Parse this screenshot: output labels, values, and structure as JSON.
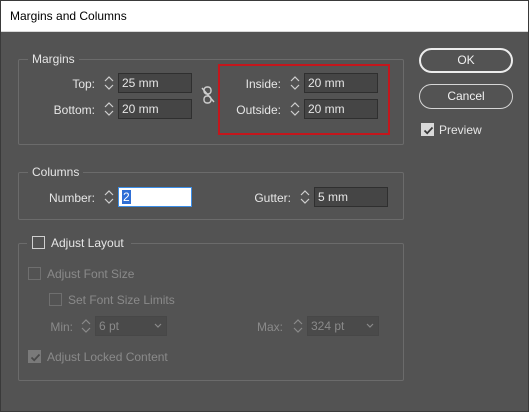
{
  "window": {
    "title": "Margins and Columns"
  },
  "margins": {
    "legend": "Margins",
    "top": {
      "label": "Top:",
      "value": "25 mm"
    },
    "bottom": {
      "label": "Bottom:",
      "value": "20 mm"
    },
    "inside": {
      "label": "Inside:",
      "value": "20 mm"
    },
    "outside": {
      "label": "Outside:",
      "value": "20 mm"
    },
    "link_icon": "broken-chain-icon"
  },
  "columns": {
    "legend": "Columns",
    "number": {
      "label": "Number:",
      "value": "2"
    },
    "gutter": {
      "label": "Gutter:",
      "value": "5 mm"
    }
  },
  "adjust_layout": {
    "label": "Adjust Layout",
    "checked": false,
    "adjust_font_size": {
      "label": "Adjust Font Size",
      "checked": false,
      "enabled": false
    },
    "set_font_size_limits": {
      "label": "Set Font Size Limits",
      "checked": false,
      "enabled": false
    },
    "min": {
      "label": "Min:",
      "value": "6 pt"
    },
    "max": {
      "label": "Max:",
      "value": "324 pt"
    },
    "adjust_locked_content": {
      "label": "Adjust Locked Content",
      "checked": true,
      "enabled": false
    }
  },
  "buttons": {
    "ok": "OK",
    "cancel": "Cancel"
  },
  "preview": {
    "label": "Preview",
    "checked": true
  },
  "colors": {
    "dialog_bg": "#535353",
    "highlight": "#c4161c",
    "focus": "#3b8ee8"
  }
}
